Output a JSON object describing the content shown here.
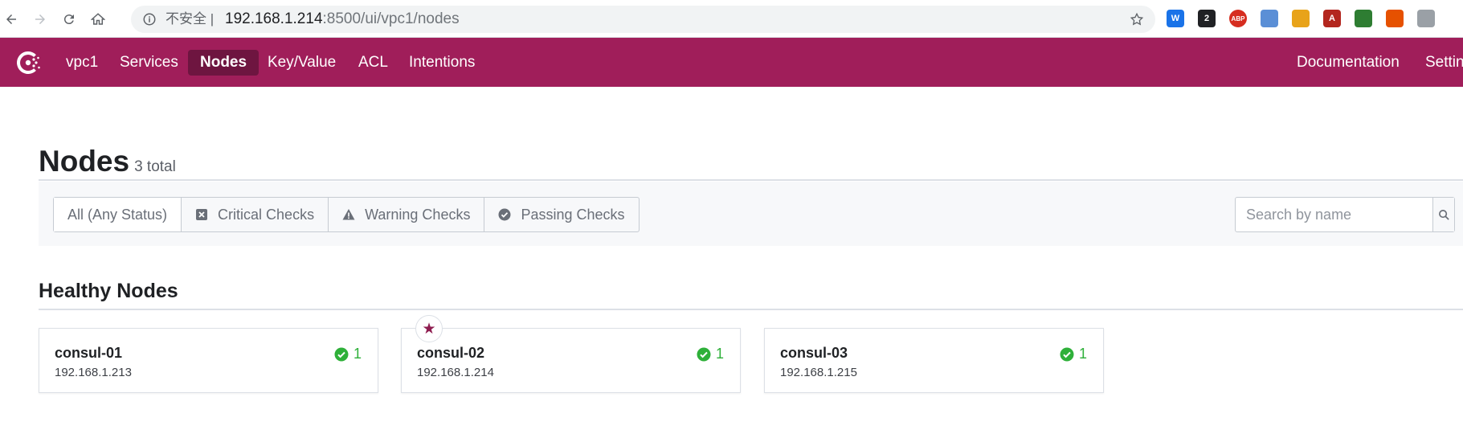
{
  "browser": {
    "insecure_label": "不安全 |",
    "url_host": "192.168.1.214",
    "url_rest": ":8500/ui/vpc1/nodes",
    "extensions": [
      {
        "name": "word-icon",
        "label": "W",
        "color": "#1a73e8"
      },
      {
        "name": "badge-extension-icon",
        "label": "2",
        "color": "#202124"
      },
      {
        "name": "adblock-icon",
        "label": "ABP",
        "color": "#d62d20"
      },
      {
        "name": "globe-extension-icon",
        "label": "",
        "color": "#5b8fd6"
      },
      {
        "name": "shield-extension-icon",
        "label": "",
        "color": "#e8a31a"
      },
      {
        "name": "a-extension-icon",
        "label": "A",
        "color": "#b3261e"
      },
      {
        "name": "leaf-extension-icon",
        "label": "",
        "color": "#2e7d32"
      },
      {
        "name": "network-extension-icon",
        "label": "",
        "color": "#e65100"
      },
      {
        "name": "cursor-extension-icon",
        "label": "",
        "color": "#9aa0a6"
      }
    ]
  },
  "header": {
    "datacenter": "vpc1",
    "nav": [
      "Services",
      "Nodes",
      "Key/Value",
      "ACL",
      "Intentions"
    ],
    "active": "Nodes",
    "right_nav": [
      "Documentation",
      "Settin"
    ]
  },
  "page": {
    "title": "Nodes",
    "total": "3 total"
  },
  "filters": {
    "all": "All (Any Status)",
    "critical": "Critical Checks",
    "warning": "Warning Checks",
    "passing": "Passing Checks"
  },
  "search": {
    "placeholder": "Search by name"
  },
  "section": {
    "title": "Healthy Nodes"
  },
  "nodes": [
    {
      "name": "consul-01",
      "address": "192.168.1.213",
      "passing": "1",
      "leader": false
    },
    {
      "name": "consul-02",
      "address": "192.168.1.214",
      "passing": "1",
      "leader": true
    },
    {
      "name": "consul-03",
      "address": "192.168.1.215",
      "passing": "1",
      "leader": false
    }
  ],
  "colors": {
    "brand": "#a01e5a",
    "nav_active": "#6e1540",
    "passing": "#2eb039",
    "leader": "#8e1c4f"
  }
}
